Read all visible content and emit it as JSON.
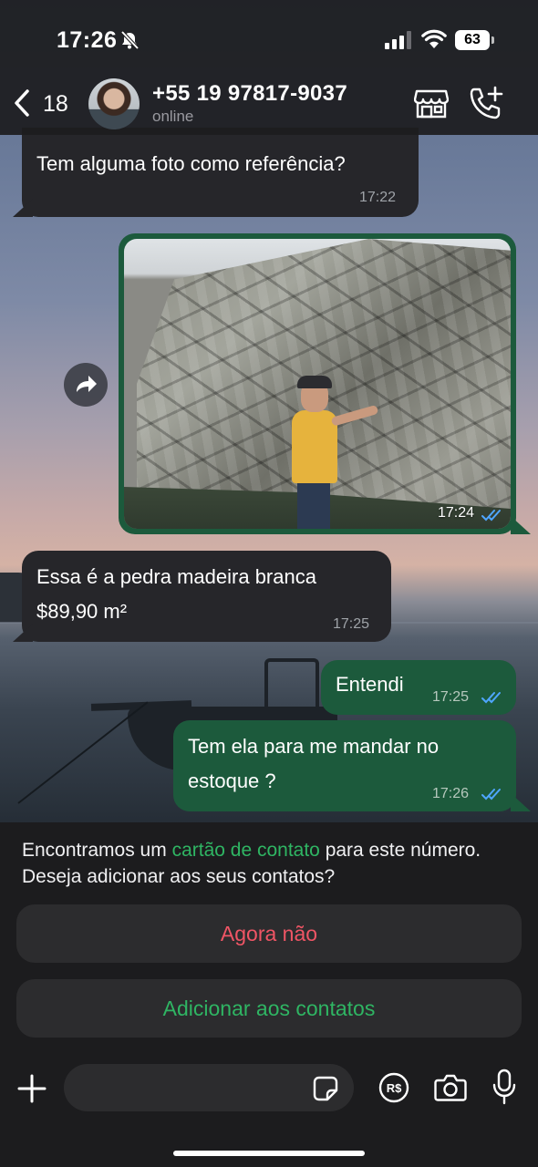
{
  "status_bar": {
    "time": "17:26",
    "battery": "63"
  },
  "header": {
    "back_count": "18",
    "contact_name": "+55 19 97817-9037",
    "contact_status": "online"
  },
  "messages": [
    {
      "direction": "in",
      "text": "Tem alguma foto como referência?",
      "time": "17:22"
    },
    {
      "direction": "out",
      "type": "photo",
      "time": "17:24",
      "read": true
    },
    {
      "direction": "in",
      "lines": [
        "Essa é a pedra madeira branca",
        "$89,90 m²"
      ],
      "time": "17:25"
    },
    {
      "direction": "out",
      "text": "Entendi",
      "time": "17:25",
      "read": true
    },
    {
      "direction": "out",
      "lines": [
        "Tem ela para me mandar no",
        "estoque ?"
      ],
      "time": "17:26",
      "read": true
    }
  ],
  "contact_card": {
    "notice_before": "Encontramos um ",
    "notice_link": "cartão de contato",
    "notice_after": " para este número. Deseja adicionar aos seus contatos?",
    "dismiss_label": "Agora não",
    "add_label": "Adicionar aos contatos"
  },
  "colors": {
    "incoming_bubble": "#26262a",
    "outgoing_bubble": "#1c5a3c",
    "accent_green": "#2fb563",
    "danger_red": "#f05565",
    "read_ticks": "#4fa6ff"
  },
  "icons": {
    "back": "chevron-left-icon",
    "store": "storefront-icon",
    "call": "add-call-icon",
    "forward": "forward-icon",
    "plus": "plus-icon",
    "sticker": "sticker-icon",
    "pay": "pix-payment-icon",
    "camera": "camera-icon",
    "mic": "microphone-icon"
  }
}
